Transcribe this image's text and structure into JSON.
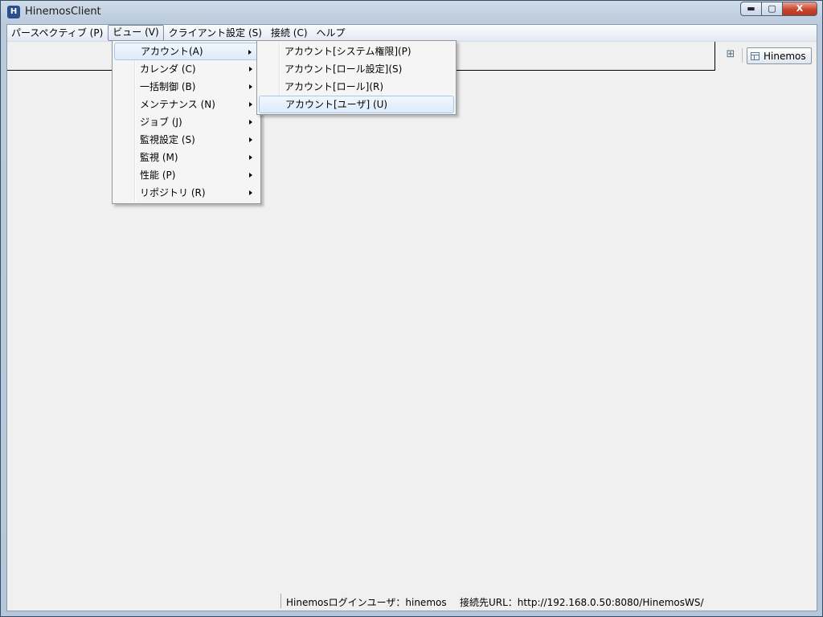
{
  "window": {
    "title": "HinemosClient",
    "app_icon": "hinemos-icon"
  },
  "window_controls": {
    "minimize": "▬",
    "maximize": "▢",
    "close": "X"
  },
  "menubar": {
    "items": [
      {
        "label": "パースペクティブ (P)"
      },
      {
        "label": "ビュー (V)",
        "active": true
      },
      {
        "label": "クライアント設定 (S)"
      },
      {
        "label": "接続 (C)"
      },
      {
        "label": "ヘルプ"
      }
    ]
  },
  "view_menu": {
    "items": [
      {
        "label": "アカウント(A)",
        "highlighted": true
      },
      {
        "label": "カレンダ (C)"
      },
      {
        "label": "一括制御 (B)"
      },
      {
        "label": "メンテナンス (N)"
      },
      {
        "label": "ジョブ (J)"
      },
      {
        "label": "監視設定 (S)"
      },
      {
        "label": "監視 (M)"
      },
      {
        "label": "性能 (P)"
      },
      {
        "label": "リポジトリ (R)"
      }
    ]
  },
  "account_submenu": {
    "items": [
      {
        "label": "アカウント[システム権限](P)"
      },
      {
        "label": "アカウント[ロール設定](S)"
      },
      {
        "label": "アカウント[ロール](R)"
      },
      {
        "label": "アカウント[ユーザ] (U)",
        "highlighted": true
      }
    ]
  },
  "perspective_bar": {
    "open_icon": "open-perspective-icon",
    "current": "Hinemos"
  },
  "statusbar": {
    "user": "Hinemosログインユーザ：hinemos",
    "url": "接続先URL：http://192.168.0.50:8080/HinemosWS/"
  }
}
